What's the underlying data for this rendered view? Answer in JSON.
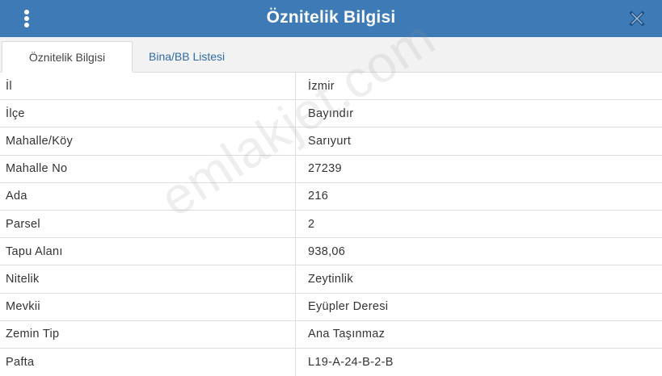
{
  "window": {
    "title": "Öznitelik Bilgisi",
    "accent_color": "#3d7ab6",
    "menu_icon": "kebab-vertical-icon",
    "close_icon": "close-icon"
  },
  "tabs": [
    {
      "label": "Öznitelik Bilgisi",
      "active": true
    },
    {
      "label": "Bina/BB Listesi",
      "active": false
    }
  ],
  "attributes": [
    {
      "key": "İl",
      "value": "İzmir"
    },
    {
      "key": "İlçe",
      "value": "Bayındır"
    },
    {
      "key": "Mahalle/Köy",
      "value": "Sarıyurt"
    },
    {
      "key": "Mahalle No",
      "value": "27239"
    },
    {
      "key": "Ada",
      "value": "216"
    },
    {
      "key": "Parsel",
      "value": "2"
    },
    {
      "key": "Tapu Alanı",
      "value": "938,06"
    },
    {
      "key": "Nitelik",
      "value": "Zeytinlik"
    },
    {
      "key": "Mevkii",
      "value": "Eyüpler Deresi"
    },
    {
      "key": "Zemin Tip",
      "value": "Ana Taşınmaz"
    },
    {
      "key": "Pafta",
      "value": "L19-A-24-B-2-B"
    }
  ],
  "watermark": "emlakjet.com"
}
